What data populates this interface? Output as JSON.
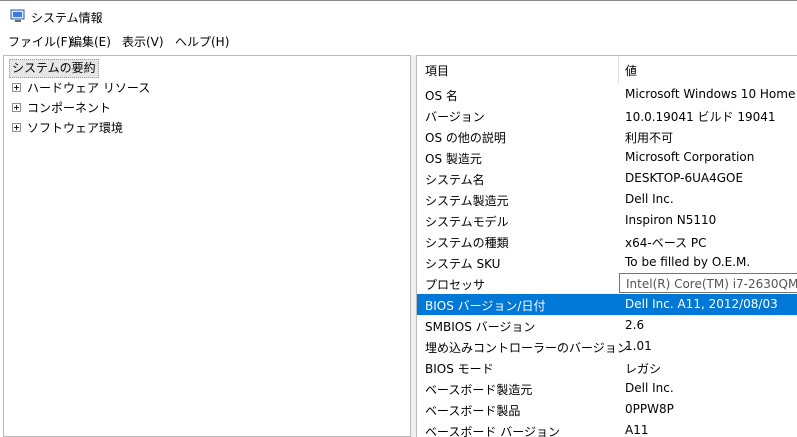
{
  "window": {
    "title": "システム情報"
  },
  "menu": [
    {
      "label": "ファイル(F)"
    },
    {
      "label": "編集(E)"
    },
    {
      "label": "表示(V)"
    },
    {
      "label": "ヘルプ(H)"
    }
  ],
  "tree": {
    "root": "システムの要約",
    "children": [
      {
        "label": "ハードウェア リソース"
      },
      {
        "label": "コンポーネント"
      },
      {
        "label": "ソフトウェア環境"
      }
    ]
  },
  "table": {
    "headers": {
      "item": "項目",
      "value": "値"
    },
    "rows": [
      {
        "item": "OS 名",
        "value": "Microsoft Windows 10 Home"
      },
      {
        "item": "バージョン",
        "value": "10.0.19041 ビルド 19041"
      },
      {
        "item": "OS の他の説明",
        "value": "利用不可"
      },
      {
        "item": "OS 製造元",
        "value": "Microsoft Corporation"
      },
      {
        "item": "システム名",
        "value": "DESKTOP-6UA4GOE"
      },
      {
        "item": "システム製造元",
        "value": "Dell Inc."
      },
      {
        "item": "システムモデル",
        "value": "Inspiron N5110"
      },
      {
        "item": "システムの種類",
        "value": "x64-ベース PC"
      },
      {
        "item": "システム SKU",
        "value": "To be filled by O.E.M."
      },
      {
        "item": "プロセッサ",
        "value": "",
        "tooltip": "Intel(R) Core(TM) i7-2630QM"
      },
      {
        "item": "BIOS バージョン/日付",
        "value": "Dell Inc. A11, 2012/08/03",
        "selected": true
      },
      {
        "item": "SMBIOS バージョン",
        "value": "2.6"
      },
      {
        "item": "埋め込みコントローラーのバージョン",
        "value": "1.01"
      },
      {
        "item": "BIOS モード",
        "value": "レガシ"
      },
      {
        "item": "ベースボード製造元",
        "value": "Dell Inc."
      },
      {
        "item": "ベースボード製品",
        "value": "0PPW8P"
      },
      {
        "item": "ベースボード バージョン",
        "value": "A11"
      }
    ]
  },
  "colors": {
    "selection": "#0078d7"
  }
}
